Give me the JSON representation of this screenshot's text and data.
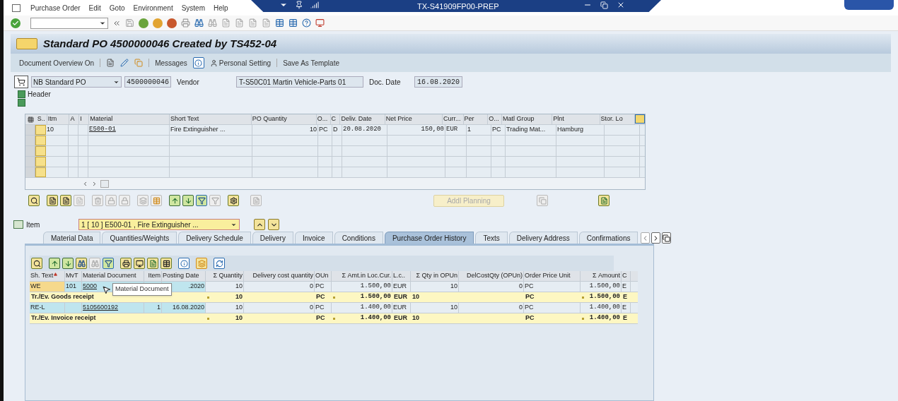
{
  "menu": [
    "Purchase Order",
    "Edit",
    "Goto",
    "Environment",
    "System",
    "Help"
  ],
  "system_title": "TX-S41909FP00-PREP",
  "title": "Standard PO 4500000046 Created by TS452-04",
  "app_toolbar": {
    "document_overview": "Document Overview On",
    "messages": "Messages",
    "personal_setting": "Personal Setting",
    "save_template": "Save As Template"
  },
  "header": {
    "doc_type": "NB Standard PO",
    "po_number": "4500000046",
    "vendor_label": "Vendor",
    "vendor": "T-S50C01 Martin Vehicle-Parts 01",
    "date_label": "Doc. Date",
    "date": "16.08.2020",
    "header_label": "Header"
  },
  "items_table": {
    "columns": [
      "S..",
      "Itm",
      "A",
      "I",
      "Material",
      "Short Text",
      "PO Quantity",
      "O...",
      "C",
      "Deliv. Date",
      "Net Price",
      "Curr...",
      "Per",
      "O...",
      "Matl Group",
      "Plnt",
      "Stor. Lo"
    ],
    "rows": [
      [
        "",
        "10",
        "",
        "",
        "E500-01",
        "Fire Extinguisher ...",
        "10",
        "PC",
        "D",
        "20.08.2020",
        "150,00",
        "EUR",
        "1",
        "PC",
        "Trading Mat...",
        "Hamburg",
        ""
      ]
    ]
  },
  "addl_planning": {
    "label": "Addl Planning",
    "disabled": true
  },
  "item_selector": {
    "label": "Item",
    "value": "1 [ 10 ] E500-01 , Fire Extinguisher ..."
  },
  "tabs": [
    {
      "label": "Material Data",
      "selected": false
    },
    {
      "label": "Quantities/Weights",
      "selected": false
    },
    {
      "label": "Delivery Schedule",
      "selected": false
    },
    {
      "label": "Delivery",
      "selected": false
    },
    {
      "label": "Invoice",
      "selected": false
    },
    {
      "label": "Conditions",
      "selected": false
    },
    {
      "label": "Purchase Order History",
      "selected": true
    },
    {
      "label": "Texts",
      "selected": false
    },
    {
      "label": "Delivery Address",
      "selected": false
    },
    {
      "label": "Confirmations",
      "selected": false
    }
  ],
  "history": {
    "columns": [
      "Sh. Text",
      "MvT",
      "Material Document",
      "Item",
      "Posting Date",
      "Σ Quantity",
      "Delivery cost quantity",
      "OUn",
      "Σ Amt.in Loc.Cur.",
      "L.c..",
      "Σ Qty in OPUn",
      "DelCostQty (OPUn)",
      "Order Price Unit",
      "Σ Amount",
      "C"
    ],
    "rows": [
      {
        "kind": "detail",
        "cells": [
          "WE",
          "101",
          "5000",
          "",
          ".2020",
          "10",
          "0",
          "PC",
          "1.500,00",
          "EUR",
          "10",
          "0",
          "PC",
          "1.500,00",
          "E"
        ]
      },
      {
        "kind": "total",
        "cells": [
          "Tr./Ev. Goods receipt",
          "",
          "",
          "",
          "",
          "10",
          "",
          "PC",
          "1.500,00",
          "EUR",
          "10",
          "",
          "PC",
          "1.500,00",
          "E"
        ]
      },
      {
        "kind": "detail",
        "cells": [
          "RE-L",
          "",
          "5105600192",
          "1",
          "16.08.2020",
          "10",
          "0",
          "PC",
          "1.400,00",
          "EUR",
          "10",
          "0",
          "PC",
          "1.400,00",
          "E"
        ]
      },
      {
        "kind": "total",
        "cells": [
          "Tr./Ev. Invoice receipt",
          "",
          "",
          "",
          "",
          "10",
          "",
          "PC",
          "1.400,00",
          "EUR",
          "10",
          "",
          "PC",
          "1.400,00",
          "E"
        ]
      }
    ],
    "tooltip": "Material Document"
  }
}
